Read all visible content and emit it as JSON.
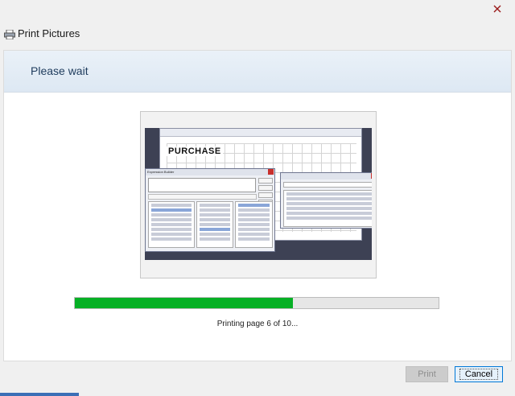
{
  "window": {
    "title": "Print Pictures",
    "close_label": "close"
  },
  "header": {
    "title": "Please wait"
  },
  "preview": {
    "form_title": "PURCHASE",
    "dialog_title": "Expression Builder"
  },
  "progress": {
    "fraction": 0.6,
    "status_text": "Printing page 6 of 10..."
  },
  "buttons": {
    "print_label": "Print",
    "cancel_label": "Cancel"
  },
  "colors": {
    "progress_fill": "#06b025",
    "header_text": "#1e3b5c",
    "accent": "#0078d7"
  }
}
